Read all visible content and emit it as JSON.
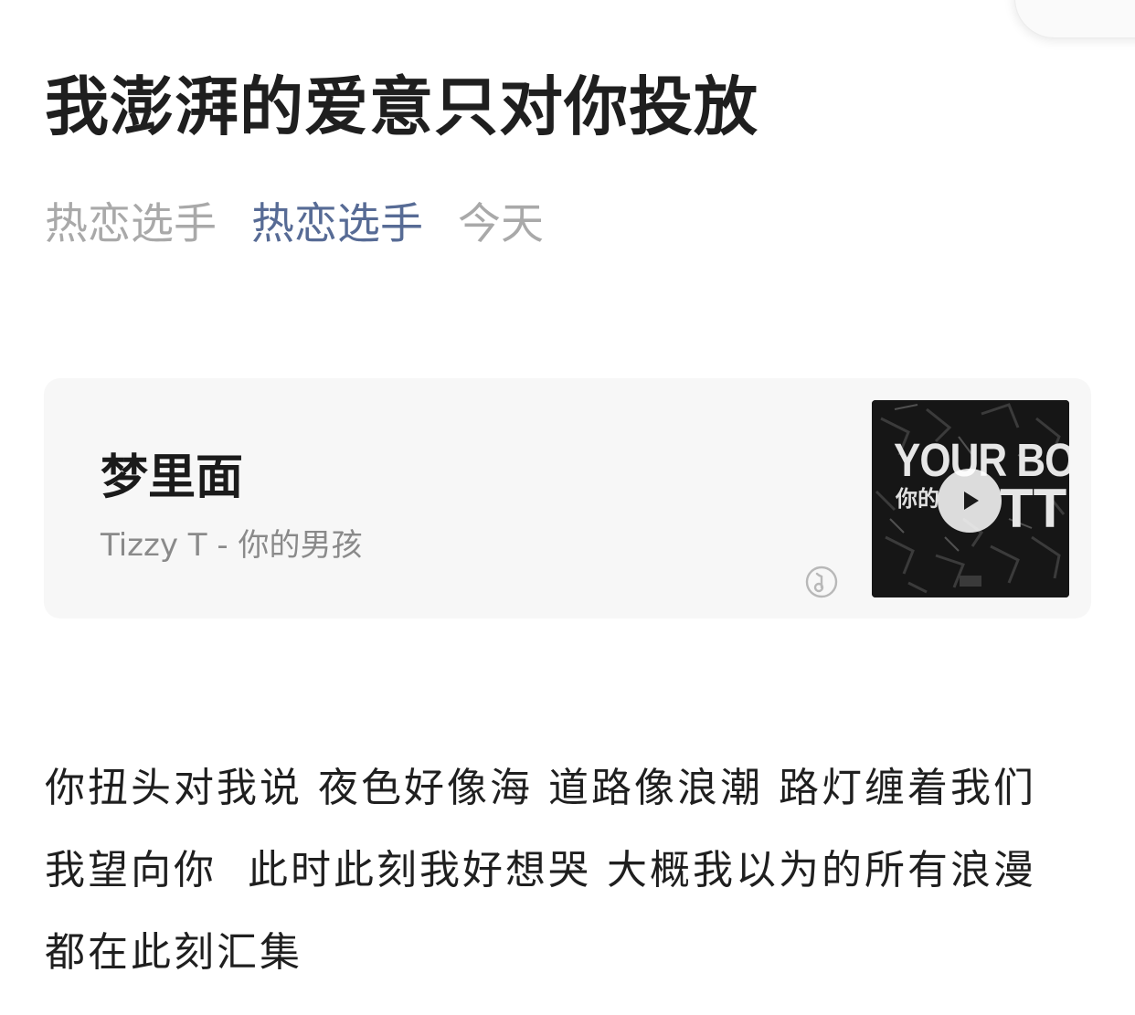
{
  "article": {
    "title": "我澎湃的爱意只对你投放",
    "author": "热恋选手",
    "account": "热恋选手",
    "date": "今天"
  },
  "music_card": {
    "song_title": "梦里面",
    "artist_line": "Tizzy T - 你的男孩",
    "cover": {
      "line1": "YOUR BOY",
      "line2": "你的",
      "line3": "TT"
    },
    "play_icon": "play-icon",
    "source_icon": "music-note-icon"
  },
  "body": {
    "lines": [
      "你扭头对我说 夜色好像海 道路像浪潮 路灯缠着我们",
      "我望向你  此时此刻我好想哭 大概我以为的所有浪漫",
      "都在此刻汇集"
    ]
  },
  "colors": {
    "account_link": "#576b95",
    "meta_gray": "#a9a9a9",
    "card_bg": "#f7f7f7"
  }
}
